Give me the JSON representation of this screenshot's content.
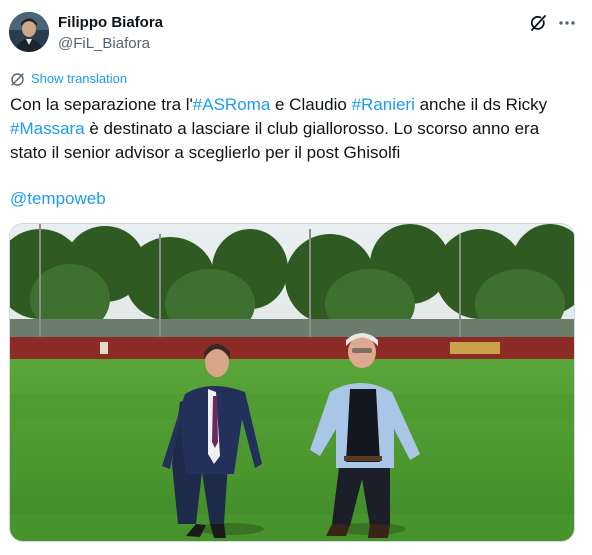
{
  "author": {
    "display_name": "Filippo Biafora",
    "handle": "@FiL_Biafora"
  },
  "translation": {
    "label": "Show translation"
  },
  "tweet": {
    "line1": {
      "t1": "Con la separazione tra l'",
      "h1": "#ASRoma",
      "t2": " e Claudio ",
      "h2": "#Ranieri",
      "t3": " anche il ds Ricky"
    },
    "line2": {
      "h1": "#Massara",
      "t1": " è destinato a lasciare il club giallorosso. Lo scorso anno era"
    },
    "line3": "stato il senior advisor a sceglierlo per il post Ghisolfi",
    "mention": "@tempoweb"
  },
  "icons": {
    "grok": "grok-icon",
    "more": "more-dots-icon",
    "translate": "globe-translate-icon"
  },
  "colors": {
    "link": "#1d9bf0",
    "text": "#0f1419",
    "secondary": "#536471",
    "pitch": "#4c9a2e"
  }
}
